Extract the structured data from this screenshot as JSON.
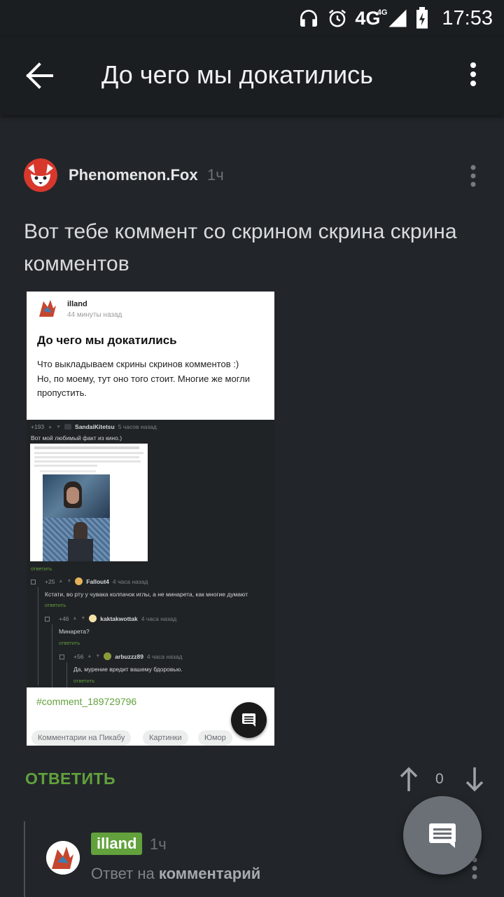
{
  "status_bar": {
    "network": "4G",
    "network_sup": "4G",
    "time": "17:53"
  },
  "app_bar": {
    "title": "До чего мы докатились"
  },
  "post": {
    "author": "Phenomenon.Fox",
    "time": "1ч",
    "text": "Вот тебе коммент со скрином скрина скрина комментов"
  },
  "screenshot": {
    "user": "illand",
    "ago": "44 минуты назад",
    "title": "До чего мы докатились",
    "body": "Что выкладываем скрины скринов комментов :)\nНо, по моему, тут оно того стоит. Многие же могли пропустить.",
    "comments": [
      {
        "score": "+193",
        "nick": "SandaiKitetsu",
        "ago": "5 часов назад",
        "text": "Вот мой любимый факт из кино.)",
        "reply": "ответить"
      },
      {
        "score": "+25",
        "nick": "Fallout4",
        "ago": "4 часа назад",
        "text": "Кстати, во рту у чувака колпачок иглы, а не минарета, как многие думают",
        "reply": "ответить"
      },
      {
        "score": "+46",
        "nick": "kaktakwottak",
        "ago": "4 часа назад",
        "text": "Минарета?",
        "reply": "ответить"
      },
      {
        "score": "+56",
        "nick": "arbuzzz89",
        "ago": "4 часа назад",
        "text": "Да, мурение вредит вашему бдоровью.",
        "reply": "ответить"
      }
    ],
    "link": "#comment_189729796",
    "tags": [
      "Комментарии на Пикабу",
      "Картинки",
      "Юмор"
    ]
  },
  "actions": {
    "reply": "ОТВЕТИТЬ",
    "votes": "0"
  },
  "reply_comment": {
    "author": "illand",
    "time": "1ч",
    "sub_prefix": "Ответ на",
    "sub_target": "комментарий"
  },
  "colors": {
    "background": "#22262a",
    "accent": "#62a13c",
    "bar": "#1b1e21"
  }
}
